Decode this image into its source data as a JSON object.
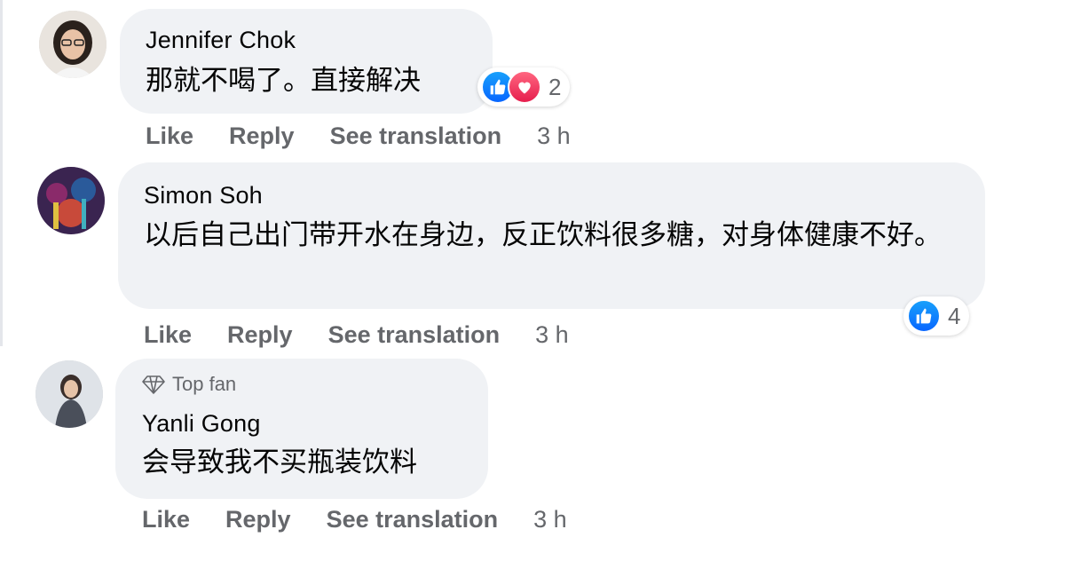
{
  "comments": [
    {
      "author": "Jennifer Chok",
      "text": "那就不喝了。直接解决",
      "reactions": {
        "icons": [
          "like-icon",
          "love-icon"
        ],
        "count": "2"
      },
      "actions": {
        "like": "Like",
        "reply": "Reply",
        "translate": "See translation",
        "time": "3 h"
      }
    },
    {
      "author": "Simon Soh",
      "text": "以后自己出门带开水在身边，反正饮料很多糖，对身体健康不好。",
      "reactions": {
        "icons": [
          "like-icon"
        ],
        "count": "4"
      },
      "actions": {
        "like": "Like",
        "reply": "Reply",
        "translate": "See translation",
        "time": "3 h"
      }
    },
    {
      "badge": "Top fan",
      "author": "Yanli Gong",
      "text": "会导致我不买瓶装饮料",
      "actions": {
        "like": "Like",
        "reply": "Reply",
        "translate": "See translation",
        "time": "3 h"
      }
    }
  ],
  "colors": {
    "bubble": "#f0f2f5",
    "secondary_text": "#65676b",
    "like_blue": "#0866ff",
    "love_red": "#e61e4d"
  }
}
